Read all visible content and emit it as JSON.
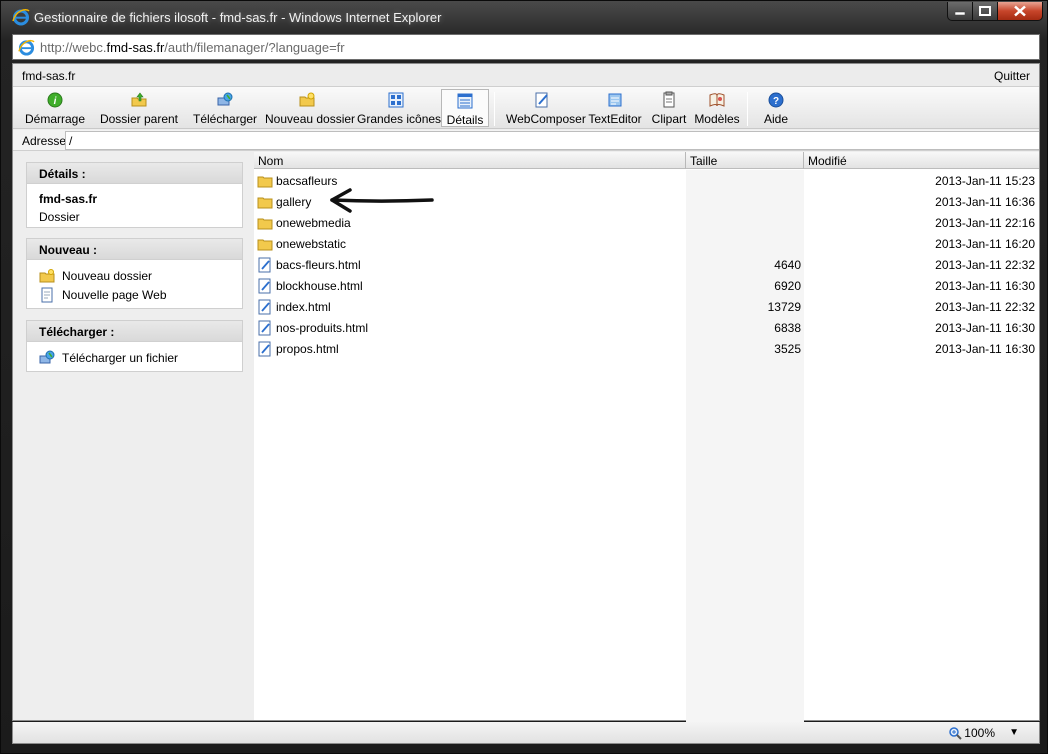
{
  "window": {
    "title": "Gestionnaire de fichiers ilosoft - fmd-sas.fr - Windows Internet Explorer",
    "url_prefix": "http://webc.",
    "url_domain": "fmd-sas.fr",
    "url_suffix": "/auth/filemanager/?language=fr"
  },
  "header": {
    "site": "fmd-sas.fr",
    "quit": "Quitter"
  },
  "toolbar": {
    "demarrage": "Démarrage",
    "dossier_parent": "Dossier parent",
    "telecharger": "Télécharger",
    "nouveau_dossier": "Nouveau dossier",
    "grandes_icones": "Grandes icônes",
    "details": "Détails",
    "webcomposer": "WebComposer",
    "texteditor": "TextEditor",
    "clipart": "Clipart",
    "modeles": "Modèles",
    "aide": "Aide"
  },
  "address": {
    "label": "Adresse",
    "value": "/"
  },
  "panel": {
    "details": {
      "title": "Détails :",
      "name": "fmd-sas.fr",
      "type": "Dossier"
    },
    "nouveau": {
      "title": "Nouveau :",
      "folder": "Nouveau dossier",
      "page": "Nouvelle page Web"
    },
    "telecharger": {
      "title": "Télécharger :",
      "file": "Télécharger un fichier"
    }
  },
  "columns": {
    "name": "Nom",
    "size": "Taille",
    "modified": "Modifié"
  },
  "files": [
    {
      "name": "bacsafleurs",
      "type": "folder",
      "size": "",
      "modified": "2013-Jan-11 15:23"
    },
    {
      "name": "gallery",
      "type": "folder",
      "size": "",
      "modified": "2013-Jan-11 16:36"
    },
    {
      "name": "onewebmedia",
      "type": "folder",
      "size": "",
      "modified": "2013-Jan-11 22:16"
    },
    {
      "name": "onewebstatic",
      "type": "folder",
      "size": "",
      "modified": "2013-Jan-11 16:20"
    },
    {
      "name": "bacs-fleurs.html",
      "type": "html",
      "size": "4640",
      "modified": "2013-Jan-11 22:32"
    },
    {
      "name": "blockhouse.html",
      "type": "html",
      "size": "6920",
      "modified": "2013-Jan-11 16:30"
    },
    {
      "name": "index.html",
      "type": "html",
      "size": "13729",
      "modified": "2013-Jan-11 22:32"
    },
    {
      "name": "nos-produits.html",
      "type": "html",
      "size": "6838",
      "modified": "2013-Jan-11 16:30"
    },
    {
      "name": "propos.html",
      "type": "html",
      "size": "3525",
      "modified": "2013-Jan-11 16:30"
    }
  ],
  "status": {
    "zoom": "100%"
  },
  "colors": {
    "folder": "#f2c94c",
    "accent": "#2c6fce",
    "close": "#c7452a"
  }
}
